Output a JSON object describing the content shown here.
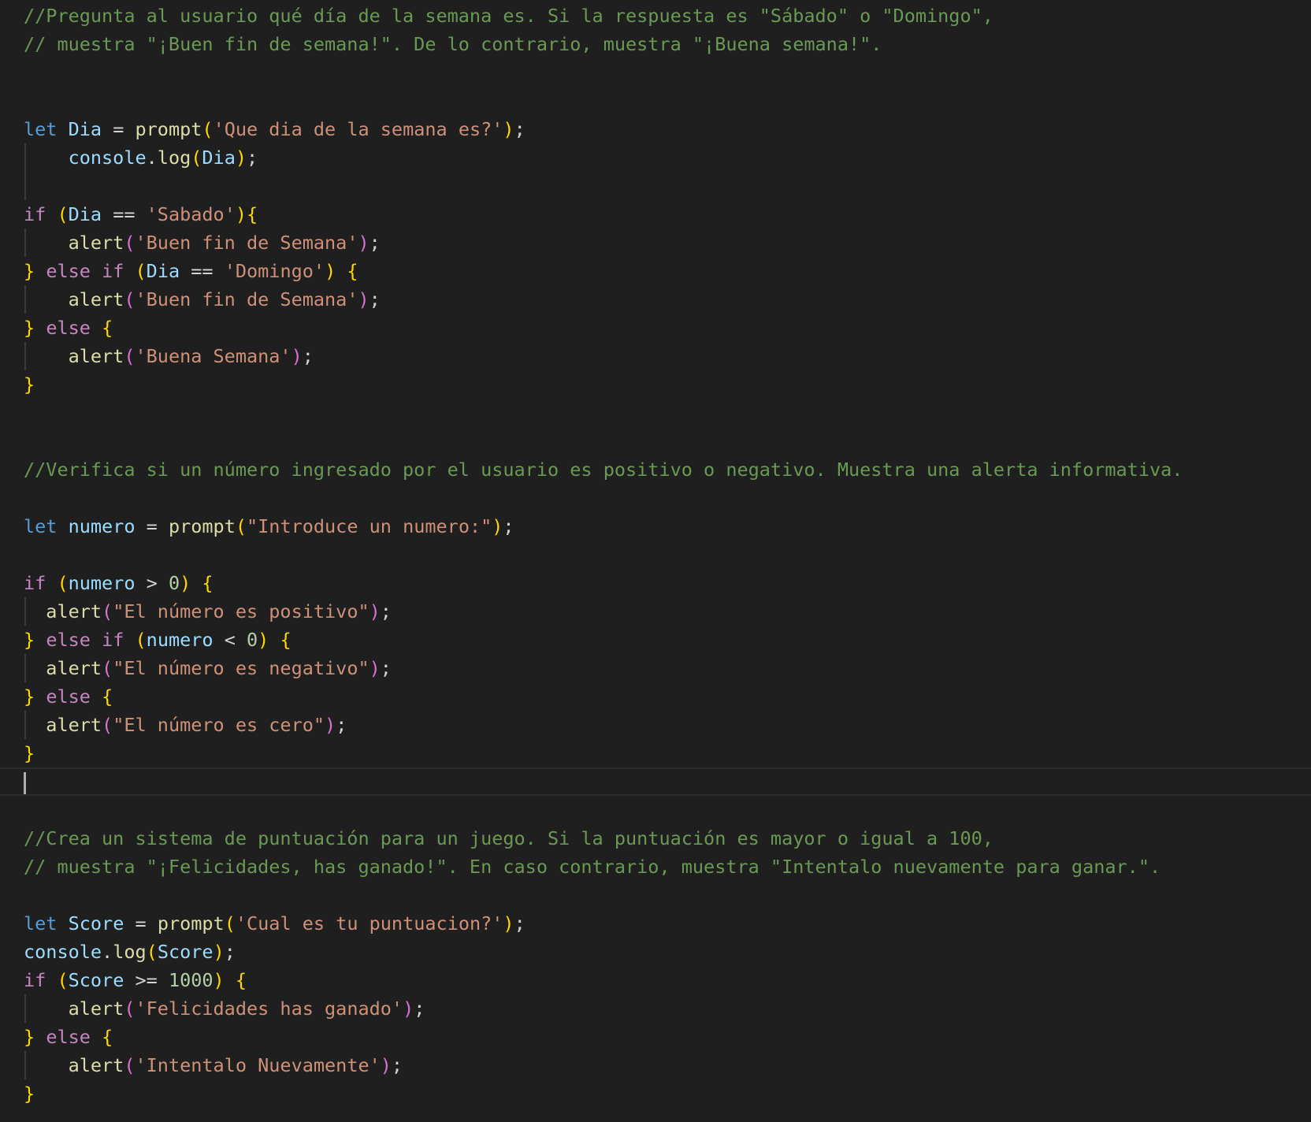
{
  "editor": {
    "language": "javascript",
    "colors": {
      "background": "#1f1f1f",
      "comment": "#6a9955",
      "keyword": "#569cd6",
      "control": "#c586c0",
      "variable": "#9cdcfe",
      "function": "#dcdcaa",
      "string": "#ce9178",
      "number": "#b5cea8",
      "bracket_level_1": "#ffd700",
      "bracket_level_2": "#da70d6"
    },
    "cursor_line": 27,
    "lines": [
      {
        "tokens": [
          {
            "t": "//Pregunta al usuario qué día de la semana es. Si la respuesta es \"Sábado\" o \"Domingo\",",
            "c": "cm"
          }
        ]
      },
      {
        "tokens": [
          {
            "t": "// muestra \"¡Buen fin de semana!\". De lo contrario, muestra \"¡Buena semana!\".",
            "c": "cm"
          }
        ]
      },
      {
        "tokens": []
      },
      {
        "tokens": []
      },
      {
        "tokens": [
          {
            "t": "let",
            "c": "kw"
          },
          {
            "t": " ",
            "c": "pl"
          },
          {
            "t": "Dia",
            "c": "var"
          },
          {
            "t": " = ",
            "c": "pl"
          },
          {
            "t": "prompt",
            "c": "fn"
          },
          {
            "t": "(",
            "c": "b1"
          },
          {
            "t": "'Que dia de la semana es?'",
            "c": "str"
          },
          {
            "t": ")",
            "c": "b1"
          },
          {
            "t": ";",
            "c": "pl"
          }
        ]
      },
      {
        "guides": [
          1
        ],
        "tokens": [
          {
            "t": "    ",
            "c": "pl"
          },
          {
            "t": "console",
            "c": "var"
          },
          {
            "t": ".",
            "c": "pl"
          },
          {
            "t": "log",
            "c": "fn"
          },
          {
            "t": "(",
            "c": "b1"
          },
          {
            "t": "Dia",
            "c": "var"
          },
          {
            "t": ")",
            "c": "b1"
          },
          {
            "t": ";",
            "c": "pl"
          }
        ]
      },
      {
        "guides": [
          1
        ],
        "tokens": []
      },
      {
        "tokens": [
          {
            "t": "if",
            "c": "ctl"
          },
          {
            "t": " ",
            "c": "pl"
          },
          {
            "t": "(",
            "c": "b1"
          },
          {
            "t": "Dia",
            "c": "var"
          },
          {
            "t": " == ",
            "c": "pl"
          },
          {
            "t": "'Sabado'",
            "c": "str"
          },
          {
            "t": ")",
            "c": "b1"
          },
          {
            "t": "{",
            "c": "b1"
          }
        ]
      },
      {
        "guides": [
          1
        ],
        "tokens": [
          {
            "t": "    ",
            "c": "pl"
          },
          {
            "t": "alert",
            "c": "fn"
          },
          {
            "t": "(",
            "c": "b2"
          },
          {
            "t": "'Buen fin de Semana'",
            "c": "str"
          },
          {
            "t": ")",
            "c": "b2"
          },
          {
            "t": ";",
            "c": "pl"
          }
        ]
      },
      {
        "tokens": [
          {
            "t": "}",
            "c": "b1"
          },
          {
            "t": " ",
            "c": "pl"
          },
          {
            "t": "else",
            "c": "ctl"
          },
          {
            "t": " ",
            "c": "pl"
          },
          {
            "t": "if",
            "c": "ctl"
          },
          {
            "t": " ",
            "c": "pl"
          },
          {
            "t": "(",
            "c": "b1"
          },
          {
            "t": "Dia",
            "c": "var"
          },
          {
            "t": " == ",
            "c": "pl"
          },
          {
            "t": "'Domingo'",
            "c": "str"
          },
          {
            "t": ")",
            "c": "b1"
          },
          {
            "t": " ",
            "c": "pl"
          },
          {
            "t": "{",
            "c": "b1"
          }
        ]
      },
      {
        "guides": [
          1
        ],
        "tokens": [
          {
            "t": "    ",
            "c": "pl"
          },
          {
            "t": "alert",
            "c": "fn"
          },
          {
            "t": "(",
            "c": "b2"
          },
          {
            "t": "'Buen fin de Semana'",
            "c": "str"
          },
          {
            "t": ")",
            "c": "b2"
          },
          {
            "t": ";",
            "c": "pl"
          }
        ]
      },
      {
        "tokens": [
          {
            "t": "}",
            "c": "b1"
          },
          {
            "t": " ",
            "c": "pl"
          },
          {
            "t": "else",
            "c": "ctl"
          },
          {
            "t": " ",
            "c": "pl"
          },
          {
            "t": "{",
            "c": "b1"
          }
        ]
      },
      {
        "guides": [
          1
        ],
        "tokens": [
          {
            "t": "    ",
            "c": "pl"
          },
          {
            "t": "alert",
            "c": "fn"
          },
          {
            "t": "(",
            "c": "b2"
          },
          {
            "t": "'Buena Semana'",
            "c": "str"
          },
          {
            "t": ")",
            "c": "b2"
          },
          {
            "t": ";",
            "c": "pl"
          }
        ]
      },
      {
        "tokens": [
          {
            "t": "}",
            "c": "b1"
          }
        ]
      },
      {
        "tokens": []
      },
      {
        "tokens": []
      },
      {
        "tokens": [
          {
            "t": "//Verifica si un número ingresado por el usuario es positivo o negativo. Muestra una alerta informativa.",
            "c": "cm"
          }
        ]
      },
      {
        "tokens": []
      },
      {
        "tokens": [
          {
            "t": "let",
            "c": "kw"
          },
          {
            "t": " ",
            "c": "pl"
          },
          {
            "t": "numero",
            "c": "var"
          },
          {
            "t": " = ",
            "c": "pl"
          },
          {
            "t": "prompt",
            "c": "fn"
          },
          {
            "t": "(",
            "c": "b1"
          },
          {
            "t": "\"Introduce un numero:\"",
            "c": "str"
          },
          {
            "t": ")",
            "c": "b1"
          },
          {
            "t": ";",
            "c": "pl"
          }
        ]
      },
      {
        "tokens": []
      },
      {
        "tokens": [
          {
            "t": "if",
            "c": "ctl"
          },
          {
            "t": " ",
            "c": "pl"
          },
          {
            "t": "(",
            "c": "b1"
          },
          {
            "t": "numero",
            "c": "var"
          },
          {
            "t": " > ",
            "c": "pl"
          },
          {
            "t": "0",
            "c": "num"
          },
          {
            "t": ")",
            "c": "b1"
          },
          {
            "t": " ",
            "c": "pl"
          },
          {
            "t": "{",
            "c": "b1"
          }
        ]
      },
      {
        "guides": [
          1
        ],
        "tokens": [
          {
            "t": "  ",
            "c": "pl"
          },
          {
            "t": "alert",
            "c": "fn"
          },
          {
            "t": "(",
            "c": "b2"
          },
          {
            "t": "\"El número es positivo\"",
            "c": "str"
          },
          {
            "t": ")",
            "c": "b2"
          },
          {
            "t": ";",
            "c": "pl"
          }
        ]
      },
      {
        "tokens": [
          {
            "t": "}",
            "c": "b1"
          },
          {
            "t": " ",
            "c": "pl"
          },
          {
            "t": "else",
            "c": "ctl"
          },
          {
            "t": " ",
            "c": "pl"
          },
          {
            "t": "if",
            "c": "ctl"
          },
          {
            "t": " ",
            "c": "pl"
          },
          {
            "t": "(",
            "c": "b1"
          },
          {
            "t": "numero",
            "c": "var"
          },
          {
            "t": " < ",
            "c": "pl"
          },
          {
            "t": "0",
            "c": "num"
          },
          {
            "t": ")",
            "c": "b1"
          },
          {
            "t": " ",
            "c": "pl"
          },
          {
            "t": "{",
            "c": "b1"
          }
        ]
      },
      {
        "guides": [
          1
        ],
        "tokens": [
          {
            "t": "  ",
            "c": "pl"
          },
          {
            "t": "alert",
            "c": "fn"
          },
          {
            "t": "(",
            "c": "b2"
          },
          {
            "t": "\"El número es negativo\"",
            "c": "str"
          },
          {
            "t": ")",
            "c": "b2"
          },
          {
            "t": ";",
            "c": "pl"
          }
        ]
      },
      {
        "tokens": [
          {
            "t": "}",
            "c": "b1"
          },
          {
            "t": " ",
            "c": "pl"
          },
          {
            "t": "else",
            "c": "ctl"
          },
          {
            "t": " ",
            "c": "pl"
          },
          {
            "t": "{",
            "c": "b1"
          }
        ]
      },
      {
        "guides": [
          1
        ],
        "tokens": [
          {
            "t": "  ",
            "c": "pl"
          },
          {
            "t": "alert",
            "c": "fn"
          },
          {
            "t": "(",
            "c": "b2"
          },
          {
            "t": "\"El número es cero\"",
            "c": "str"
          },
          {
            "t": ")",
            "c": "b2"
          },
          {
            "t": ";",
            "c": "pl"
          }
        ]
      },
      {
        "tokens": [
          {
            "t": "}",
            "c": "b1"
          }
        ]
      },
      {
        "tokens": []
      },
      {
        "tokens": []
      },
      {
        "tokens": [
          {
            "t": "//Crea un sistema de puntuación para un juego. Si la puntuación es mayor o igual a 100,",
            "c": "cm"
          }
        ]
      },
      {
        "tokens": [
          {
            "t": "// muestra \"¡Felicidades, has ganado!\". En caso contrario, muestra \"Intentalo nuevamente para ganar.\".",
            "c": "cm"
          }
        ]
      },
      {
        "tokens": []
      },
      {
        "tokens": [
          {
            "t": "let",
            "c": "kw"
          },
          {
            "t": " ",
            "c": "pl"
          },
          {
            "t": "Score",
            "c": "var"
          },
          {
            "t": " = ",
            "c": "pl"
          },
          {
            "t": "prompt",
            "c": "fn"
          },
          {
            "t": "(",
            "c": "b1"
          },
          {
            "t": "'Cual es tu puntuacion?'",
            "c": "str"
          },
          {
            "t": ")",
            "c": "b1"
          },
          {
            "t": ";",
            "c": "pl"
          }
        ]
      },
      {
        "tokens": [
          {
            "t": "console",
            "c": "var"
          },
          {
            "t": ".",
            "c": "pl"
          },
          {
            "t": "log",
            "c": "fn"
          },
          {
            "t": "(",
            "c": "b1"
          },
          {
            "t": "Score",
            "c": "var"
          },
          {
            "t": ")",
            "c": "b1"
          },
          {
            "t": ";",
            "c": "pl"
          }
        ]
      },
      {
        "tokens": [
          {
            "t": "if",
            "c": "ctl"
          },
          {
            "t": " ",
            "c": "pl"
          },
          {
            "t": "(",
            "c": "b1"
          },
          {
            "t": "Score",
            "c": "var"
          },
          {
            "t": " >= ",
            "c": "pl"
          },
          {
            "t": "1000",
            "c": "num"
          },
          {
            "t": ")",
            "c": "b1"
          },
          {
            "t": " ",
            "c": "pl"
          },
          {
            "t": "{",
            "c": "b1"
          }
        ]
      },
      {
        "guides": [
          1
        ],
        "tokens": [
          {
            "t": "    ",
            "c": "pl"
          },
          {
            "t": "alert",
            "c": "fn"
          },
          {
            "t": "(",
            "c": "b2"
          },
          {
            "t": "'Felicidades has ganado'",
            "c": "str"
          },
          {
            "t": ")",
            "c": "b2"
          },
          {
            "t": ";",
            "c": "pl"
          }
        ]
      },
      {
        "tokens": [
          {
            "t": "}",
            "c": "b1"
          },
          {
            "t": " ",
            "c": "pl"
          },
          {
            "t": "else",
            "c": "ctl"
          },
          {
            "t": " ",
            "c": "pl"
          },
          {
            "t": "{",
            "c": "b1"
          }
        ]
      },
      {
        "guides": [
          1
        ],
        "tokens": [
          {
            "t": "    ",
            "c": "pl"
          },
          {
            "t": "alert",
            "c": "fn"
          },
          {
            "t": "(",
            "c": "b2"
          },
          {
            "t": "'Intentalo Nuevamente'",
            "c": "str"
          },
          {
            "t": ")",
            "c": "b2"
          },
          {
            "t": ";",
            "c": "pl"
          }
        ]
      },
      {
        "tokens": [
          {
            "t": "}",
            "c": "b1"
          }
        ]
      }
    ]
  }
}
